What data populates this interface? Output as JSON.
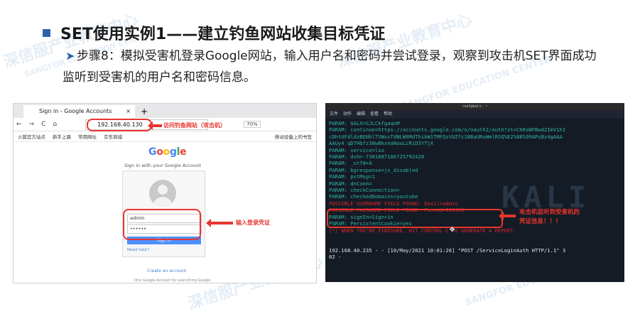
{
  "slide": {
    "title": "SET使用实例1——建立钓鱼网站收集目标凭证",
    "step": "步骤8：模拟受害机登录Google网站，输入用户名和密码并尝试登录，观察到攻击机SET界面成功监听到受害机的用户名和密码信息。",
    "arrow_icon": "➤",
    "watermarks": [
      "深信服产业教育中心",
      "SANGFOR EDUCATION CENTER"
    ]
  },
  "browser": {
    "tab_title": "Sign in - Google Accounts",
    "tab_close": "×",
    "new_tab": "+",
    "url": "192.168.40.130",
    "zoom": "70%",
    "nav_icons": [
      "←",
      "→",
      "C",
      "⌂"
    ],
    "bookmarks": [
      "火狐官方站点",
      "新手上路",
      "常用网址",
      "京东商城"
    ],
    "bookmarks_right": "移动设备上的书签",
    "url_annotation": "访问钓鱼网站（攻击机）",
    "logo": "Google",
    "signin_subtitle": "Sign in with your Google Account",
    "username_value": "admin",
    "password_value": "••••••",
    "signin_button": "Sign in",
    "need_help": "Need help?",
    "create_account": "Create an account",
    "footer": "One Google Account for everything Google",
    "input_annotation": "输入登录凭证"
  },
  "terminal": {
    "window_title": "root@kali: ~",
    "menu": [
      "文件",
      "动作",
      "编辑",
      "查看",
      "帮助"
    ],
    "lines": [
      {
        "text": "PARAM: GALX=SJLCkfgaqoM",
        "color": "teal"
      },
      {
        "text": "PARAM: continue=https://accounts.google.com/o/oauth2/auth?zt=ChRsWFBwd2ImV1hI",
        "color": "teal"
      },
      {
        "text": "cDhtUFdldzBENhlTVWxsTdNLW9MdThibW1TMFQzVUZfc1BBaURuWmlRSQ%E2%88%99APsBz4gAAA",
        "color": "teal"
      },
      {
        "text": "AAUy4 qD7Hbfz38wBkxnaNouLcRiD3YTjX",
        "color": "teal"
      },
      {
        "text": "PARAM: service=lso",
        "color": "teal"
      },
      {
        "text": "PARAM: dsh=-7381887106725792428",
        "color": "teal"
      },
      {
        "text": "PARAM: _utf8=â",
        "color": "teal"
      },
      {
        "text": "PARAM: bgresponse=js_disabled",
        "color": "teal"
      },
      {
        "text": "PARAM: pstMsg=1",
        "color": "teal"
      },
      {
        "text": "PARAM: dnConn=",
        "color": "teal"
      },
      {
        "text": "PARAM: checkConnection=",
        "color": "teal"
      },
      {
        "text": "PARAM: checkedDomains=youtube",
        "color": "teal"
      },
      {
        "text": "POSSIBLE USERNAME FIELD FOUND: Email=admin",
        "color": "red"
      },
      {
        "text": "POSSIBLE PASSWORD FIELD FOUND: Passwd=123456",
        "color": "red"
      },
      {
        "text": "PARAM: signIn=Sign+in",
        "color": "teal"
      },
      {
        "text": "PARAM: PersistentCookie=yes",
        "color": "teal"
      },
      {
        "text": "[*] WHEN YOU'RE FINISHED, HIT CONTROL-C TO GENERATE A REPORT.",
        "color": "red"
      },
      {
        "text": "",
        "color": "teal"
      },
      {
        "text": "",
        "color": "teal"
      },
      {
        "text": "192.168.40.235 - - [10/May/2021 10:01:26] \"POST /ServiceLoginAuth HTTP/1.1\" 3",
        "color": "white"
      },
      {
        "text": "02 -",
        "color": "white"
      }
    ],
    "kali_logo": "KALI",
    "annotation_line1": "攻击机监听到受害机的",
    "annotation_line2": "凭证信息！！！"
  }
}
